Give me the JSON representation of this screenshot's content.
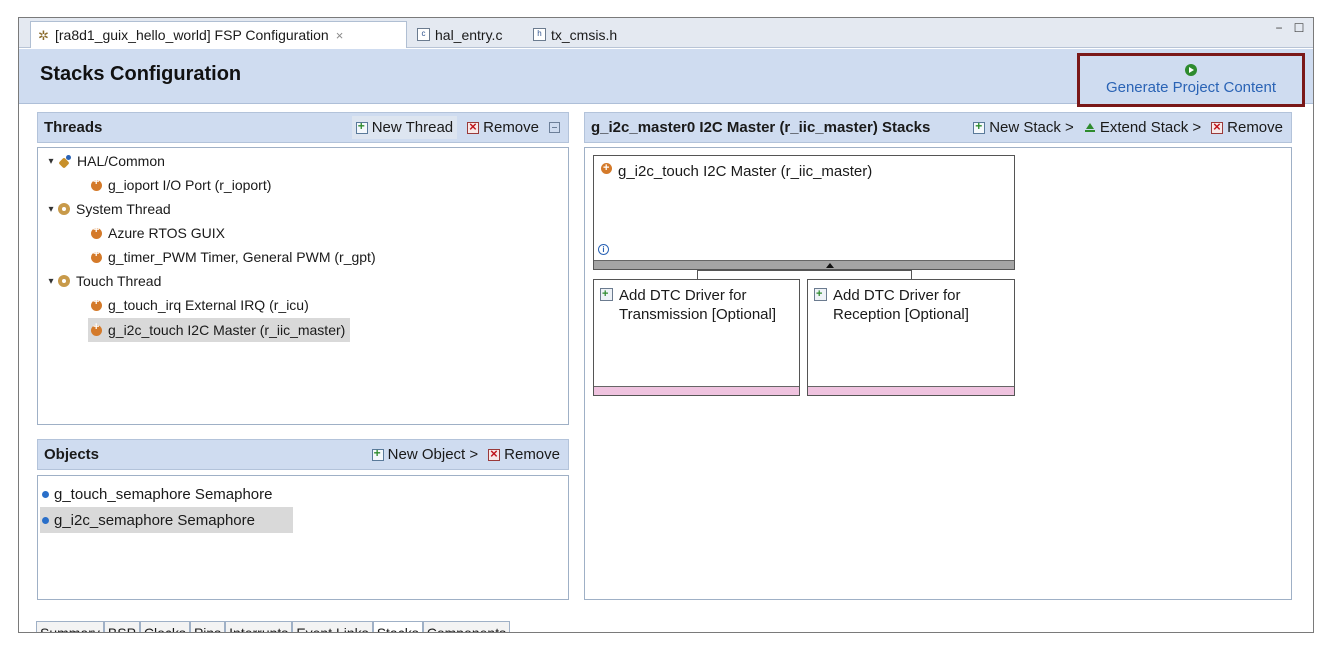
{
  "editor_tabs": [
    {
      "label": "[ra8d1_guix_hello_world] FSP Configuration",
      "close": "×",
      "icon": "gear-icon"
    },
    {
      "label": "hal_entry.c",
      "icon": "c-file-icon"
    },
    {
      "label": "tx_cmsis.h",
      "icon": "h-file-icon"
    }
  ],
  "window_controls": {
    "minimize": "−",
    "maximize": "☐"
  },
  "header": {
    "title": "Stacks Configuration",
    "generate_label": "Generate Project Content"
  },
  "threads_panel": {
    "title": "Threads",
    "new_thread": "New Thread",
    "remove": "Remove",
    "tree": [
      {
        "label": "HAL/Common",
        "twisty": "❯"
      },
      {
        "label": "g_ioport I/O Port (r_ioport)"
      },
      {
        "label": "System Thread",
        "twisty": "❯"
      },
      {
        "label": "Azure RTOS GUIX"
      },
      {
        "label": "g_timer_PWM Timer, General PWM (r_gpt)"
      },
      {
        "label": "Touch Thread",
        "twisty": "❯"
      },
      {
        "label": "g_touch_irq External IRQ (r_icu)"
      },
      {
        "label": "g_i2c_touch I2C Master (r_iic_master)"
      }
    ]
  },
  "objects_panel": {
    "title": "Objects",
    "new_object": "New Object >",
    "remove": "Remove",
    "items": [
      {
        "label": "g_touch_semaphore Semaphore"
      },
      {
        "label": "g_i2c_semaphore Semaphore"
      }
    ]
  },
  "stacks_panel": {
    "title": "g_i2c_master0 I2C Master (r_iic_master) Stacks",
    "new_stack": "New Stack >",
    "extend_stack": "Extend Stack >",
    "remove": "Remove",
    "main_block": {
      "label": "g_i2c_touch I2C Master (r_iic_master)",
      "info": "i"
    },
    "sub_blocks": [
      {
        "line1": "Add DTC Driver for",
        "line2": "Transmission [Optional]"
      },
      {
        "line1": "Add DTC Driver for",
        "line2": "Reception [Optional]"
      }
    ]
  },
  "bottom_tabs": [
    "Summary",
    "BSP",
    "Clocks",
    "Pins",
    "Interrupts",
    "Event Links",
    "Stacks",
    "Components"
  ],
  "colors": {
    "accent_blue": "#2a63b5",
    "header_bg": "#cfdcf0",
    "highlight_border": "#7a1818",
    "selection": "#d9d9d9",
    "pink_bar": "#efc3df"
  }
}
